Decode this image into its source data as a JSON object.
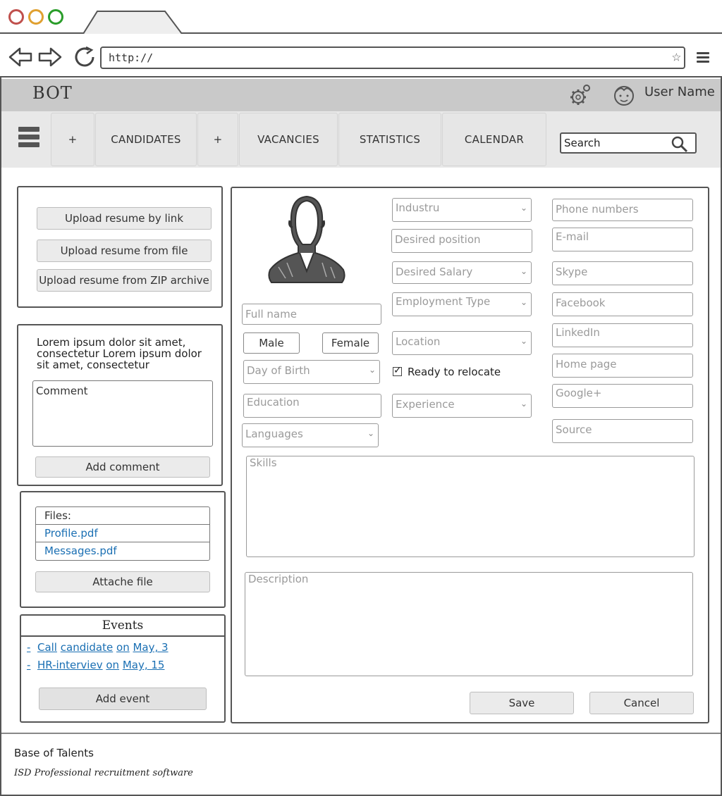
{
  "browser": {
    "url": "http://"
  },
  "header": {
    "logo": "BOT",
    "user_name": "User Name"
  },
  "nav": {
    "items": [
      {
        "label": "+"
      },
      {
        "label": "CANDIDATES"
      },
      {
        "label": "+"
      },
      {
        "label": "VACANCIES"
      },
      {
        "label": "STATISTICS"
      },
      {
        "label": "CALENDAR"
      }
    ],
    "search_placeholder": "Search"
  },
  "upload": {
    "by_link": "Upload resume by link",
    "from_file": "Upload resume from file",
    "from_zip": "Upload resume from ZIP archive"
  },
  "comment_panel": {
    "text": "Lorem ipsum dolor sit amet, consectetur  Lorem ipsum dolor sit amet, consectetur",
    "comment_placeholder": "Comment",
    "add_button": "Add comment"
  },
  "files_panel": {
    "header": "Files:",
    "files": [
      "Profile.pdf",
      "Messages.pdf"
    ],
    "attach_button": "Attache file"
  },
  "events_panel": {
    "title": "Events",
    "events": [
      {
        "dash": "-",
        "action": "Call",
        "subject": "candidate",
        "on": "on",
        "date": "May, 3"
      },
      {
        "dash": "-",
        "action": "HR-interviev",
        "subject": "",
        "on": "on",
        "date": "May, 15"
      }
    ],
    "add_button": "Add event"
  },
  "form": {
    "full_name": "Full name",
    "male": "Male",
    "female": "Female",
    "day_of_birth": "Day of Birth",
    "education": "Education",
    "languages": "Languages",
    "industry": "Industru",
    "desired_position": "Desired position",
    "desired_salary": "Desired Salary",
    "employment_type": "Employment Type",
    "location": "Location",
    "ready_to_relocate": "Ready to relocate",
    "experience": "Experience",
    "phone": "Phone numbers",
    "email": "E-mail",
    "skype": "Skype",
    "facebook": "Facebook",
    "linkedin": "LinkedIn",
    "home_page": "Home page",
    "google_plus": "Google+",
    "source": "Source",
    "skills": "Skills",
    "description": "Description",
    "save": "Save",
    "cancel": "Cancel"
  },
  "footer": {
    "title": "Base of Talents",
    "subtitle": "ISD Professional recruitment software"
  }
}
